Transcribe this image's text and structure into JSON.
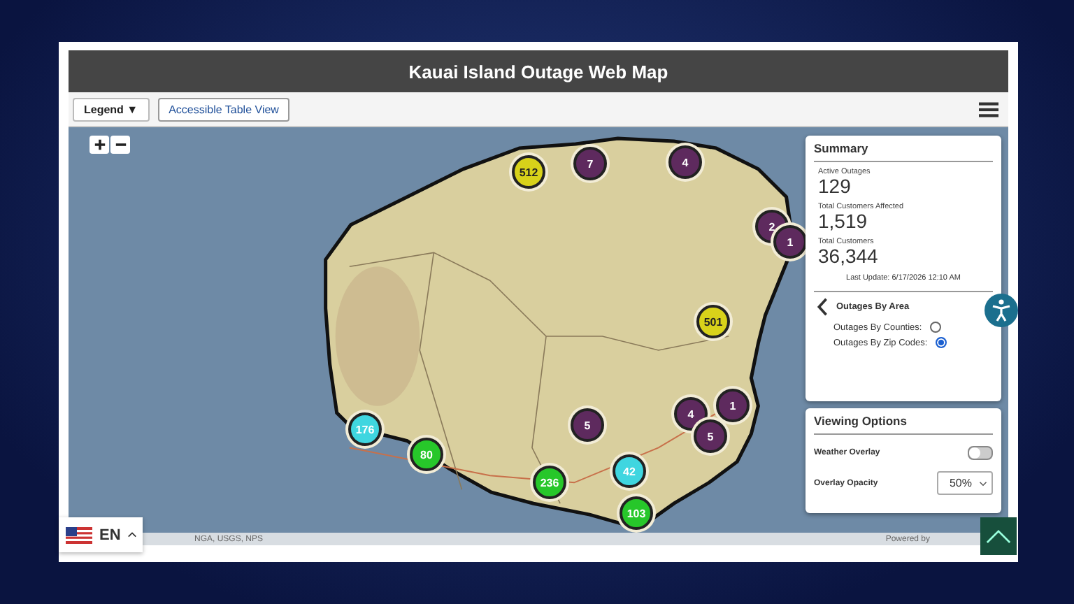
{
  "window": {
    "title": "Kauai Island Outage Web Map"
  },
  "toolbar": {
    "legend_button": "Legend ▼",
    "table_view_button": "Accessible Table View"
  },
  "map": {
    "clusters": [
      {
        "count": "512",
        "color": "#d8d21a"
      },
      {
        "count": "7",
        "color": "#5e2a5e"
      },
      {
        "count": "4",
        "color": "#5e2a5e"
      },
      {
        "count": "2",
        "color": "#5e2a5e"
      },
      {
        "count": "1",
        "color": "#5e2a5e"
      },
      {
        "count": "501",
        "color": "#d8d21a"
      },
      {
        "count": "1",
        "color": "#5e2a5e"
      },
      {
        "count": "4",
        "color": "#5e2a5e"
      },
      {
        "count": "5",
        "color": "#5e2a5e"
      },
      {
        "count": "5",
        "color": "#5e2a5e"
      },
      {
        "count": "176",
        "color": "#3fd6e0"
      },
      {
        "count": "80",
        "color": "#27c72a"
      },
      {
        "count": "236",
        "color": "#27c72a"
      },
      {
        "count": "42",
        "color": "#3fd6e0"
      },
      {
        "count": "103",
        "color": "#27c72a"
      }
    ],
    "attribution": "NGA, USGS, NPS",
    "powered_by": "Powered by"
  },
  "summary": {
    "title": "Summary",
    "stats": [
      {
        "label": "Active Outages",
        "value": "129"
      },
      {
        "label": "Total Customers Affected",
        "value": "1,519"
      },
      {
        "label": "Total Customers",
        "value": "36,344"
      }
    ],
    "last_update": "Last Update: 6/17/2026 12:10 AM",
    "area_title": "Outages By Area",
    "area_options": [
      {
        "label": "Outages By Counties:",
        "selected": false
      },
      {
        "label": "Outages By Zip Codes:",
        "selected": true
      }
    ]
  },
  "viewing_options": {
    "title": "Viewing Options",
    "weather_overlay": {
      "label": "Weather Overlay",
      "on": false
    },
    "overlay_opacity": {
      "label": "Overlay Opacity",
      "value": "50%"
    }
  },
  "language": {
    "code": "EN"
  }
}
